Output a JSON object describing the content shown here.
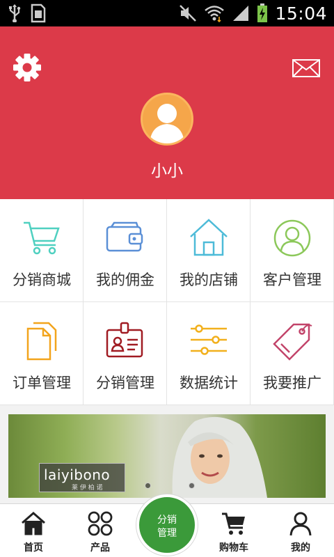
{
  "status_bar": {
    "time": "15:04",
    "icons": [
      "usb-icon",
      "sim-icon",
      "mute-icon",
      "wifi-icon",
      "signal-icon",
      "battery-charging-icon"
    ]
  },
  "header": {
    "background": "#dc3a49",
    "username": "小小",
    "settings_icon": "gear-icon",
    "mail_icon": "envelope-icon"
  },
  "grid": {
    "items": [
      {
        "label": "分销商城",
        "icon": "shopping-cart-icon",
        "color": "#4fd0c0"
      },
      {
        "label": "我的佣金",
        "icon": "wallet-icon",
        "color": "#5a8fd6"
      },
      {
        "label": "我的店铺",
        "icon": "house-icon",
        "color": "#4dbbd8"
      },
      {
        "label": "客户管理",
        "icon": "user-circle-icon",
        "color": "#8cc85a"
      },
      {
        "label": "订单管理",
        "icon": "documents-icon",
        "color": "#f2a41c"
      },
      {
        "label": "分销管理",
        "icon": "id-badge-icon",
        "color": "#a01b22"
      },
      {
        "label": "数据统计",
        "icon": "sliders-icon",
        "color": "#f2b01c"
      },
      {
        "label": "我要推广",
        "icon": "price-tag-icon",
        "color": "#c2446a"
      }
    ]
  },
  "banner": {
    "brand": "laiyibono",
    "brand_sub": "莱 伊 柏 诺",
    "slide_count": 2,
    "active_slide": 1
  },
  "bottom_nav": {
    "items": [
      {
        "label": "首页",
        "icon": "home-icon"
      },
      {
        "label": "产品",
        "icon": "grid-circles-icon"
      },
      {
        "label": "购物车",
        "icon": "cart-icon"
      },
      {
        "label": "我的",
        "icon": "person-icon"
      }
    ],
    "center": {
      "line1": "分销",
      "line2": "管理",
      "color": "#3b9a3a"
    }
  }
}
